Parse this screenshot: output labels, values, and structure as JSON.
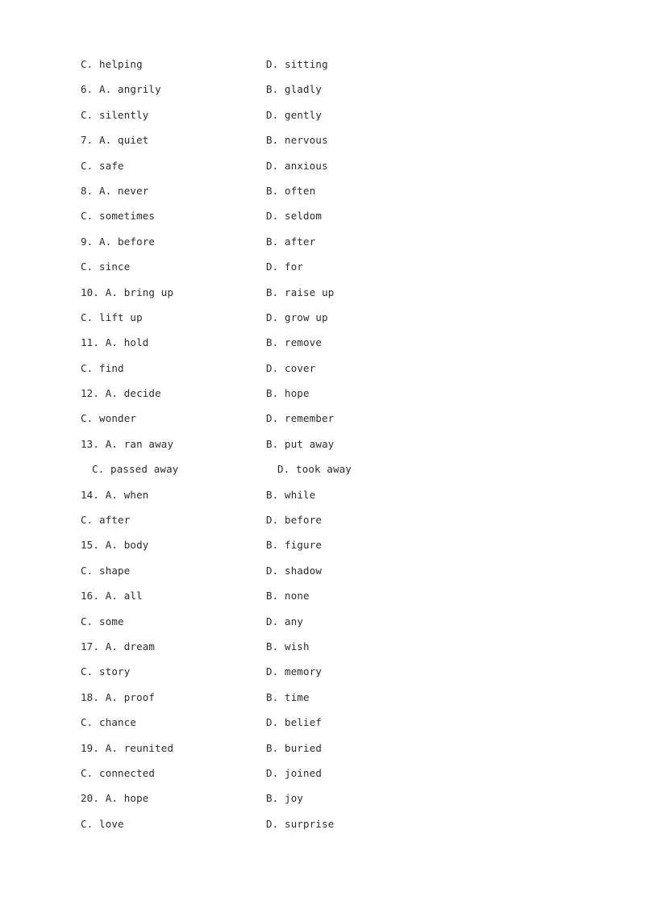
{
  "document": {
    "type": "multiple-choice-answer-options",
    "page_background": "#ffffff",
    "text_color": "#2b2b2b",
    "lines": [
      {
        "left": "C. helping",
        "right": "D. sitting",
        "left_indent": 0
      },
      {
        "left": "6. A. angrily",
        "right": "B. gladly",
        "left_indent": 0
      },
      {
        "left": "C. silently",
        "right": "D. gently",
        "left_indent": 0
      },
      {
        "left": "7. A. quiet",
        "right": "B. nervous",
        "left_indent": 0
      },
      {
        "left": "C. safe",
        "right": "D. anxious",
        "left_indent": 0
      },
      {
        "left": "8. A. never",
        "right": "B. often",
        "left_indent": 0
      },
      {
        "left": "C. sometimes",
        "right": "D. seldom",
        "left_indent": 0
      },
      {
        "left": "9. A. before",
        "right": "B. after",
        "left_indent": 0
      },
      {
        "left": "C. since",
        "right": "D. for",
        "left_indent": 0
      },
      {
        "left": "10. A. bring up",
        "right": "B. raise up",
        "left_indent": 0
      },
      {
        "left": "C. lift up",
        "right": "D. grow up",
        "left_indent": 0
      },
      {
        "left": "11. A. hold",
        "right": "B. remove",
        "left_indent": 0
      },
      {
        "left": "C. find",
        "right": "D. cover",
        "left_indent": 0
      },
      {
        "left": "12. A. decide",
        "right": "B. hope",
        "left_indent": 0
      },
      {
        "left": "C. wonder",
        "right": "D. remember",
        "left_indent": 0
      },
      {
        "left": "13. A. ran away",
        "right": "B. put away",
        "left_indent": 0
      },
      {
        "left": "C. passed away",
        "right": "D. took away",
        "left_indent": 1
      },
      {
        "left": "14. A. when",
        "right": "B. while",
        "left_indent": 0
      },
      {
        "left": "C. after",
        "right": "D. before",
        "left_indent": 0
      },
      {
        "left": "15. A. body",
        "right": "B. figure",
        "left_indent": 0
      },
      {
        "left": "C. shape",
        "right": "D. shadow",
        "left_indent": 0
      },
      {
        "left": "16. A. all",
        "right": "B. none",
        "left_indent": 0
      },
      {
        "left": "C. some",
        "right": "D. any",
        "left_indent": 0
      },
      {
        "left": "17. A. dream",
        "right": "B. wish",
        "left_indent": 0
      },
      {
        "left": "C. story",
        "right": "D. memory",
        "left_indent": 0
      },
      {
        "left": "18. A. proof",
        "right": "B. time",
        "left_indent": 0
      },
      {
        "left": "C. chance",
        "right": "D. belief",
        "left_indent": 0
      },
      {
        "left": "19. A. reunited",
        "right": "B. buried",
        "left_indent": 0
      },
      {
        "left": "C. connected",
        "right": "D. joined",
        "left_indent": 0
      },
      {
        "left": "20. A. hope",
        "right": "B. joy",
        "left_indent": 0
      },
      {
        "left": "C. love",
        "right": "D. surprise",
        "left_indent": 0
      }
    ]
  }
}
